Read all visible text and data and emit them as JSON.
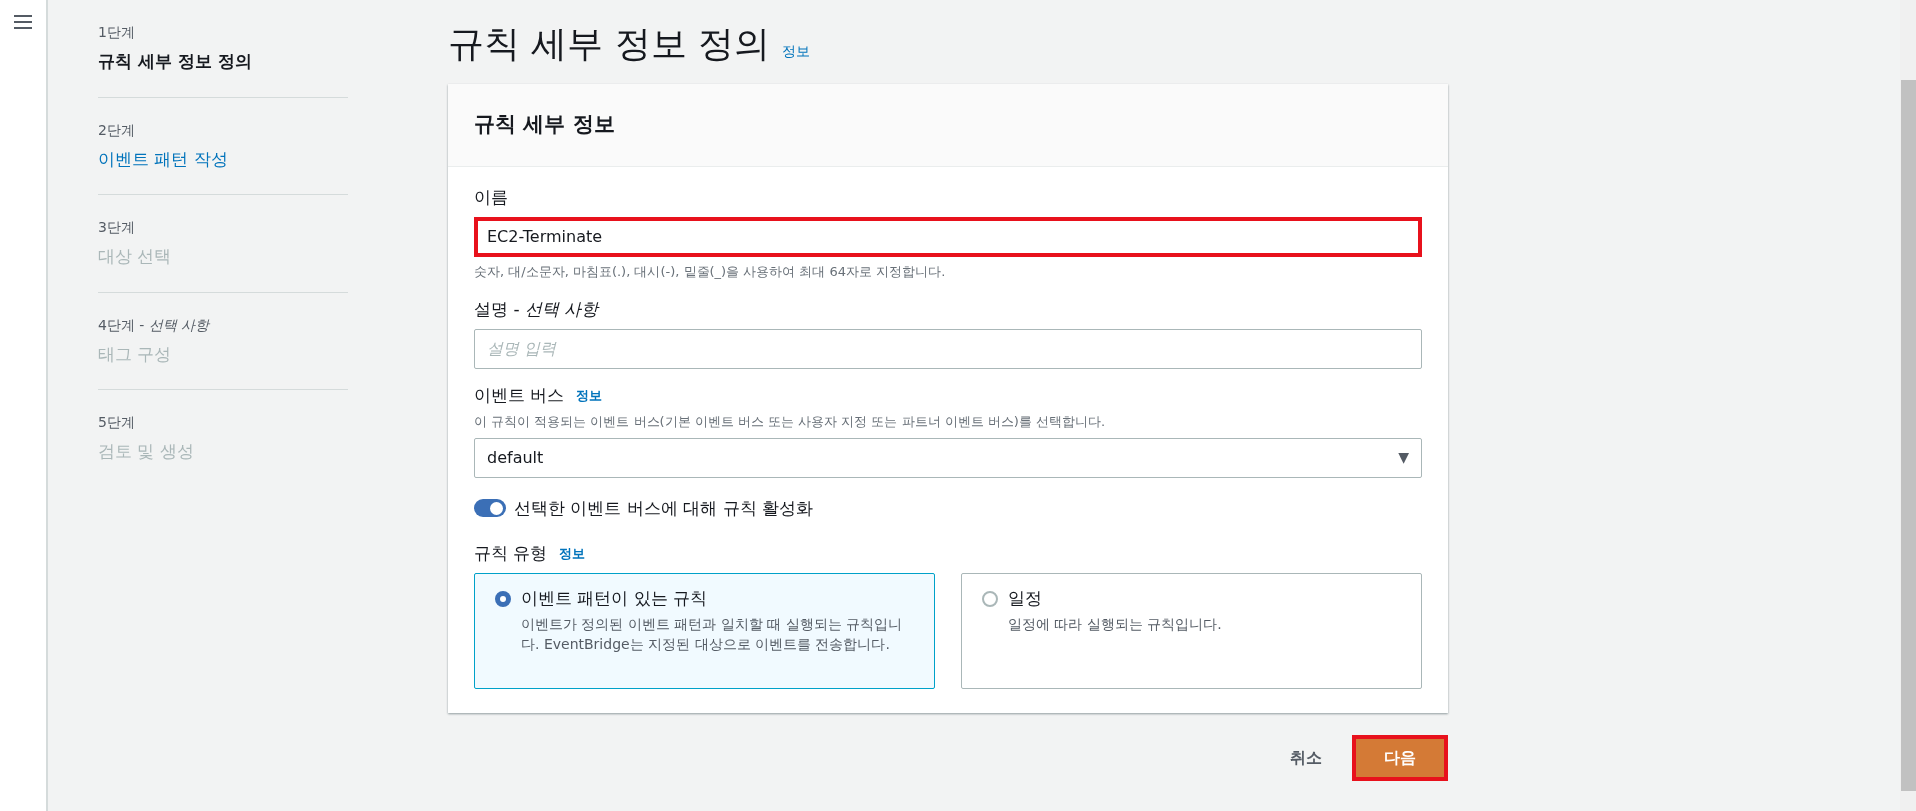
{
  "steps": [
    {
      "step": "1단계",
      "name": "규칙 세부 정보 정의",
      "selected": true,
      "disabled": false
    },
    {
      "step": "2단계",
      "name": "이벤트 패턴 작성",
      "selected": false,
      "disabled": false
    },
    {
      "step": "3단계",
      "name": "대상 선택",
      "selected": false,
      "disabled": true
    },
    {
      "step": "4단계 - *선택 사항*",
      "name": "태그 구성",
      "selected": false,
      "disabled": true
    },
    {
      "step": "5단계",
      "name": "검토 및 생성",
      "selected": false,
      "disabled": true
    }
  ],
  "page": {
    "title": "규칙 세부 정보 정의",
    "info_link": "정보"
  },
  "card": {
    "title": "규칙 세부 정보",
    "name_field": {
      "label": "이름",
      "value": "EC2-Terminate",
      "highlighted": true,
      "hint": "숫자, 대/소문자, 마침표(.), 대시(-), 밑줄(_)을 사용하여 최대 64자로 지정합니다."
    },
    "description_field": {
      "label": "설명 - *선택 사항*",
      "placeholder": "설명 입력"
    },
    "event_bus": {
      "label": "이벤트 버스",
      "info_link": "정보",
      "hint": "이 규칙이 적용되는 이벤트 버스(기본 이벤트 버스 또는 사용자 지정 또는 파트너 이벤트 버스)를 선택합니다.",
      "value": "default",
      "caret": "▼"
    },
    "enable_toggle": {
      "label": "선택한 이벤트 버스에 대해 규칙 활성화",
      "on": true
    },
    "rule_type": {
      "label": "규칙 유형",
      "info_link": "정보",
      "options": [
        {
          "title": "이벤트 패턴이 있는 규칙",
          "description": "이벤트가 정의된 이벤트 패턴과 일치할 때 실행되는 규칙입니다. EventBridge는 지정된 대상으로 이벤트를 전송합니다.",
          "selected": true
        },
        {
          "title": "일정",
          "description": "일정에 따라 실행되는 규칙입니다.",
          "selected": false
        }
      ]
    }
  },
  "actions": {
    "cancel": "취소",
    "next": {
      "label": "다음",
      "highlighted": true
    }
  }
}
